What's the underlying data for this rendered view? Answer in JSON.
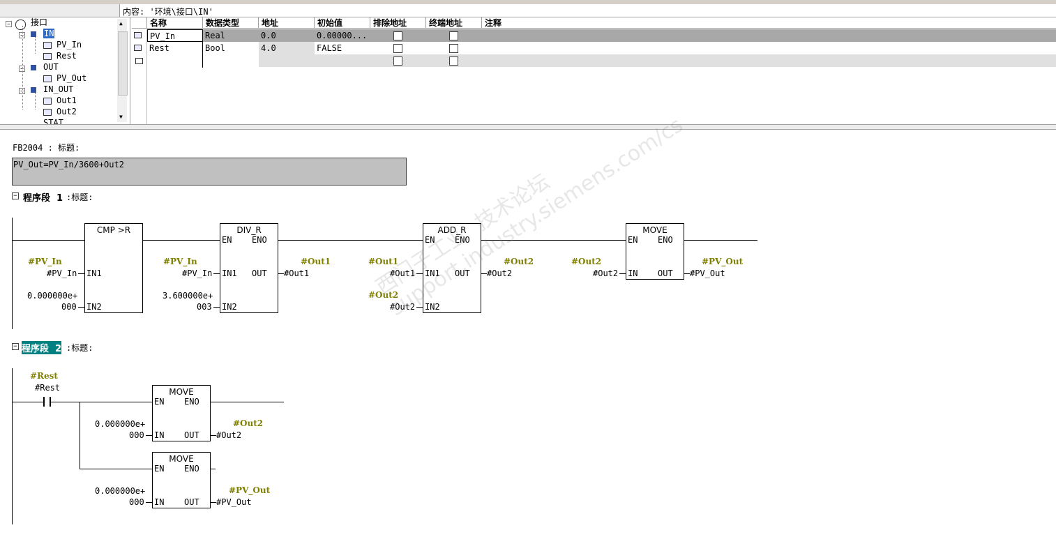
{
  "path_bar": {
    "text": "内容: '环境\\接口\\IN'"
  },
  "tree": {
    "root": "接口",
    "nodes": [
      {
        "label": "IN",
        "selected": true
      },
      {
        "label": "PV_In"
      },
      {
        "label": "Rest"
      },
      {
        "label": "OUT"
      },
      {
        "label": "PV_Out"
      },
      {
        "label": "IN_OUT"
      },
      {
        "label": "Out1"
      },
      {
        "label": "Out2"
      },
      {
        "label": "STAT"
      }
    ]
  },
  "table": {
    "headers": [
      "名称",
      "数据类型",
      "地址",
      "初始值",
      "排除地址",
      "终端地址",
      "注释"
    ],
    "rows": [
      {
        "name": "PV_In",
        "type": "Real",
        "address": "0.0",
        "init": "0.00000...",
        "exclude": false,
        "terminal": false,
        "comment": ""
      },
      {
        "name": "Rest",
        "type": "Bool",
        "address": "4.0",
        "init": "FALSE",
        "exclude": false,
        "terminal": false,
        "comment": ""
      },
      {
        "name": "",
        "type": "",
        "address": "",
        "init": "",
        "exclude": false,
        "terminal": false,
        "comment": ""
      }
    ]
  },
  "block": {
    "title": "FB2004 : 标题:",
    "comment": "PV_Out=PV_In/3600+Out2"
  },
  "network1": {
    "header": "程序段  1",
    "title_suffix": ":标题:",
    "cmp": {
      "title": "CMP >R",
      "in1_label": "#PV_In",
      "in1": "#PV_In",
      "in2_a": "0.000000e+",
      "in2_b": "000",
      "pin_in1": "IN1",
      "pin_in2": "IN2"
    },
    "div": {
      "title": "DIV_R",
      "en": "EN",
      "eno": "ENO",
      "in1_label": "#PV_In",
      "in1": "#PV_In",
      "in2_a": "3.600000e+",
      "in2_b": "003",
      "pin_in1": "IN1",
      "pin_in2": "IN2",
      "pin_out": "OUT",
      "out_label": "#Out1",
      "out": "#Out1"
    },
    "add": {
      "title": "ADD_R",
      "en": "EN",
      "eno": "ENO",
      "in1_label": "#Out1",
      "in1": "#Out1",
      "in2_label": "#Out2",
      "in2": "#Out2",
      "pin_in1": "IN1",
      "pin_in2": "IN2",
      "pin_out": "OUT",
      "out_label": "#Out2",
      "out": "#Out2"
    },
    "move": {
      "title": "MOVE",
      "en": "EN",
      "eno": "ENO",
      "in_label": "#Out2",
      "in": "#Out2",
      "pin_in": "IN",
      "pin_out": "OUT",
      "out_label": "#PV_Out",
      "out": "#PV_Out"
    }
  },
  "network2": {
    "header": "程序段  2",
    "title_suffix": ":标题:",
    "contact_label": "#Rest",
    "contact": "#Rest",
    "move1": {
      "title": "MOVE",
      "en": "EN",
      "eno": "ENO",
      "in_a": "0.000000e+",
      "in_b": "000",
      "pin_in": "IN",
      "pin_out": "OUT",
      "out_label": "#Out2",
      "out": "#Out2"
    },
    "move2": {
      "title": "MOVE",
      "en": "EN",
      "eno": "ENO",
      "in_a": "0.000000e+",
      "in_b": "000",
      "pin_in": "IN",
      "pin_out": "OUT",
      "out_label": "#PV_Out",
      "out": "#PV_Out"
    }
  },
  "watermark": "西门子工业  技术论坛\nsupport.industry.siemens.com/cs",
  "colors": {
    "selection": "#316ac5",
    "olive": "#808000",
    "row_gray": "#a8a8a8"
  }
}
